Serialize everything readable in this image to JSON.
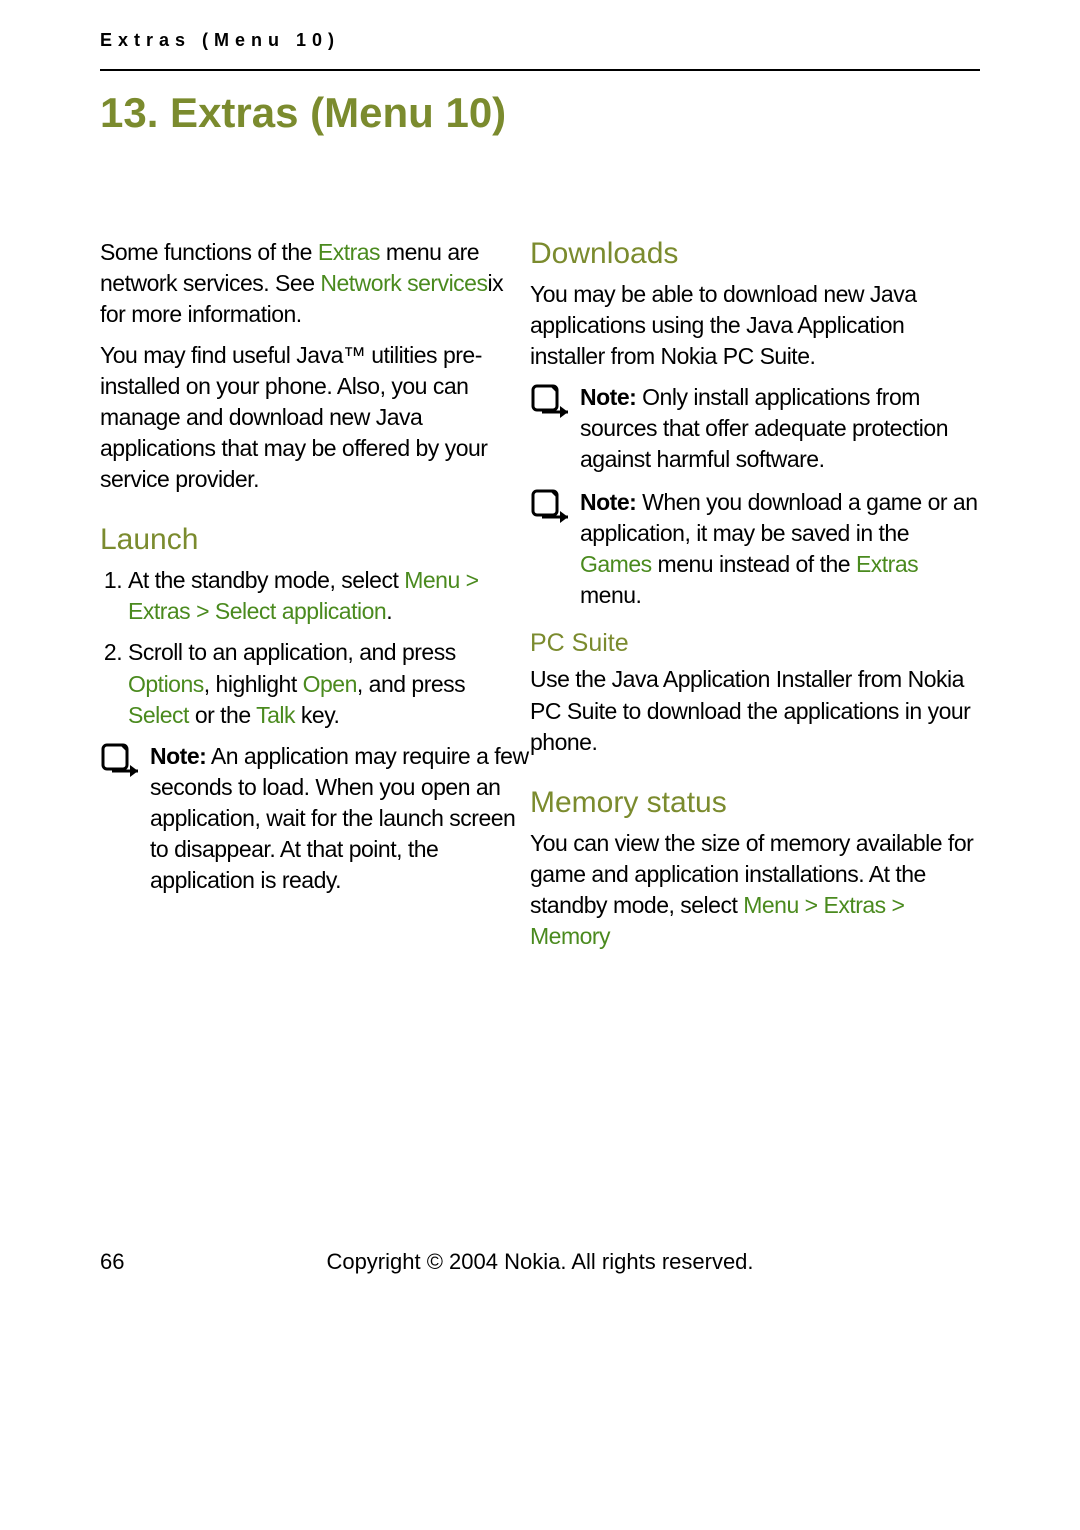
{
  "header": {
    "running": "Extras (Menu 10)"
  },
  "chapter": {
    "title": "13. Extras (Menu 10)"
  },
  "left": {
    "intro1_pre": "Some functions of the",
    "intro1_green1": "Extras",
    "intro1_mid": " menu are network services. See",
    "intro1_xref": "Network services",
    "intro1_post": "ix for more information.",
    "intro2": "You may find useful Java™ utilities pre-installed on your phone. Also, you can manage and download new Java applications that may be offered by your service provider.",
    "launch_h": "Launch",
    "li1_pre": "At the standby mode, select ",
    "li1_path": "Menu > Extras > Select application",
    "li1_post": ".",
    "li2_a": "Scroll to an application, and press ",
    "li2_g1": "Options",
    "li2_b": ", highlight",
    "li2_g2": "Open",
    "li2_c": ", and press",
    "li2_g3": "Select",
    "li2_d": " or the",
    "li2_g4": "Talk",
    "li2_e": " key.",
    "note1_label": "Note:",
    "note1_text": " An application may require a few seconds to load. When you open an application, wait for the launch screen to disappear. At that point, the application is ready."
  },
  "right": {
    "downloads_h": "Downloads",
    "downloads_p": "You may be able to download new Java applications using the Java Application installer from Nokia PC Suite.",
    "noteA_label": "Note:",
    "noteA_text": " Only install applications from sources that offer adequate protection against harmful software.",
    "noteB_label": "Note:",
    "noteB_pre": " When you download a game or an application, it may be saved in the",
    "noteB_g1": "Games",
    "noteB_mid": " menu instead of the",
    "noteB_g2": "Extras",
    "noteB_post": " menu.",
    "pcsuite_h": "PC Suite",
    "pcsuite_p": "Use the Java Application Installer from Nokia PC Suite to download the applications in your phone.",
    "memory_h": "Memory status",
    "memory_pre": "You can view the size of memory available for game and application installations. At the standby mode, select",
    "memory_path": "Menu > Extras > Memory"
  },
  "footer": {
    "page": "66",
    "copyright": "Copyright © 2004 Nokia. All rights reserved."
  }
}
